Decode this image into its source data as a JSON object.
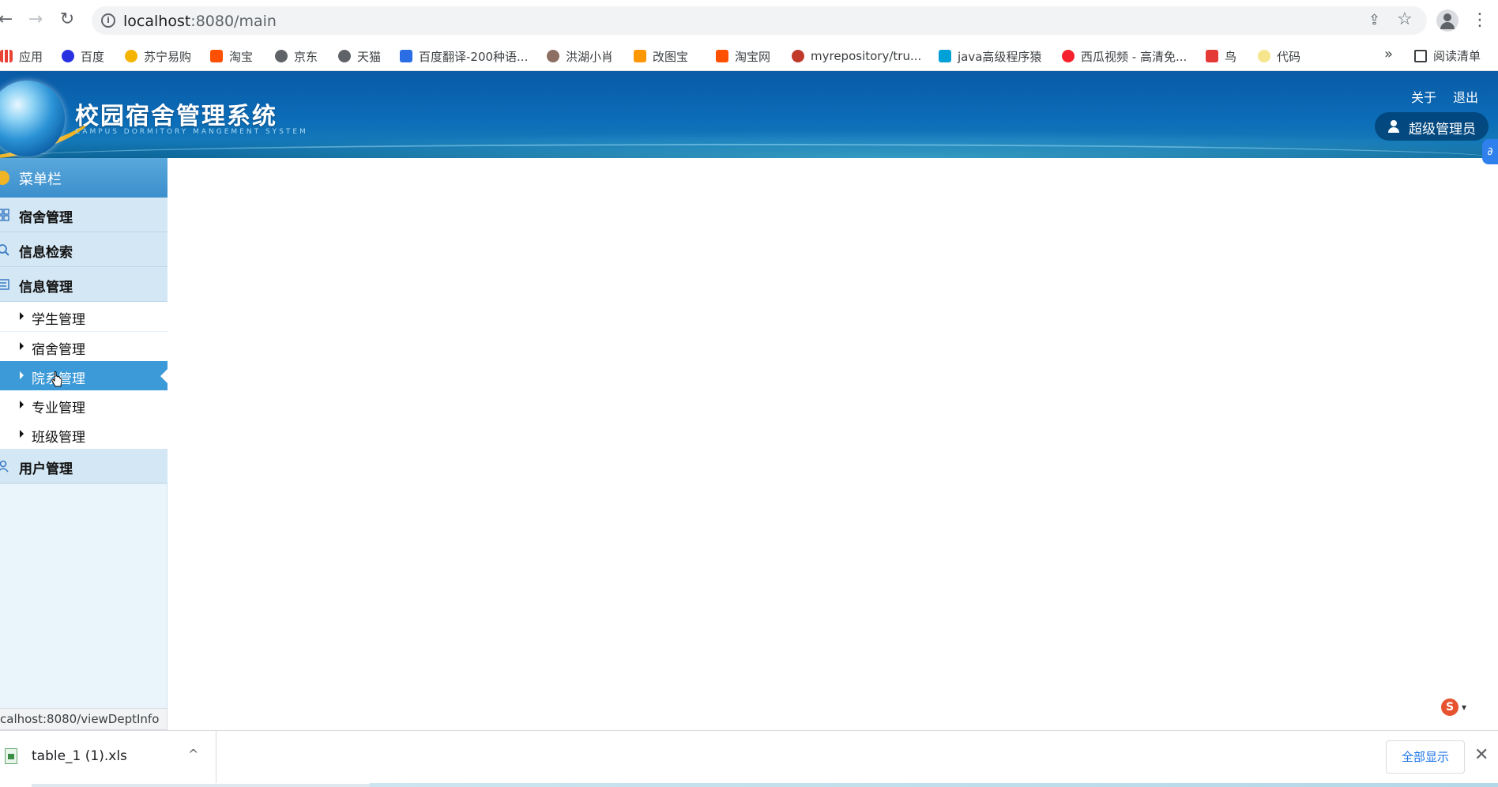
{
  "browser": {
    "url_host": "localhost",
    "url_path": ":8080/main",
    "nav": {
      "back": "←",
      "forward": "→",
      "reload": "↻"
    },
    "more_menu": "⋮",
    "share_glyph": "⇪",
    "star_glyph": "☆"
  },
  "bookmarks": [
    {
      "label": "应用",
      "color": "#e94235"
    },
    {
      "label": "百度",
      "color": "#2932e1"
    },
    {
      "label": "苏宁易购",
      "color": "#f5b400"
    },
    {
      "label": "淘宝",
      "color": "#ff5000"
    },
    {
      "label": "京东",
      "color": "#5f6368"
    },
    {
      "label": "天猫",
      "color": "#5f6368"
    },
    {
      "label": "百度翻译-200种语...",
      "color": "#2b6de5"
    },
    {
      "label": "洪湖小肖",
      "color": "#8d6e63"
    },
    {
      "label": "改图宝",
      "color": "#ff9800"
    },
    {
      "label": "淘宝网",
      "color": "#ff5000"
    },
    {
      "label": "myrepository/tru...",
      "color": "#c0392b"
    },
    {
      "label": "java高级程序猿",
      "color": "#00a1d6"
    },
    {
      "label": "西瓜视频 - 高清免...",
      "color": "#f5222d"
    },
    {
      "label": "鸟",
      "color": "#e53935"
    },
    {
      "label": "代码",
      "color": "#f6e58d"
    }
  ],
  "bookmarks_more": "»",
  "reading_list": "阅读清单",
  "app": {
    "title": "校园宿舍管理系统",
    "subtitle": "CAMPUS DORMITORY MANGEMENT SYSTEM",
    "links": {
      "about": "关于",
      "logout": "退出"
    },
    "user": "超级管理员",
    "plugin_glyph": "∂"
  },
  "sidebar": {
    "header": "菜单栏",
    "sections": [
      {
        "label": "宿舍管理"
      },
      {
        "label": "信息检索"
      },
      {
        "label": "信息管理"
      },
      {
        "label": "用户管理"
      }
    ],
    "info_items": [
      {
        "label": "学生管理"
      },
      {
        "label": "宿舍管理"
      },
      {
        "label": "院系管理"
      },
      {
        "label": "专业管理"
      },
      {
        "label": "班级管理"
      }
    ],
    "active_item": "院系管理"
  },
  "status_url": "calhost:8080/viewDeptInfo",
  "widget": {
    "glyph": "S",
    "arrow": "▾"
  },
  "downloads": {
    "file": "table_1 (1).xls",
    "chevron": "^",
    "show_all": "全部显示",
    "close": "✕"
  }
}
